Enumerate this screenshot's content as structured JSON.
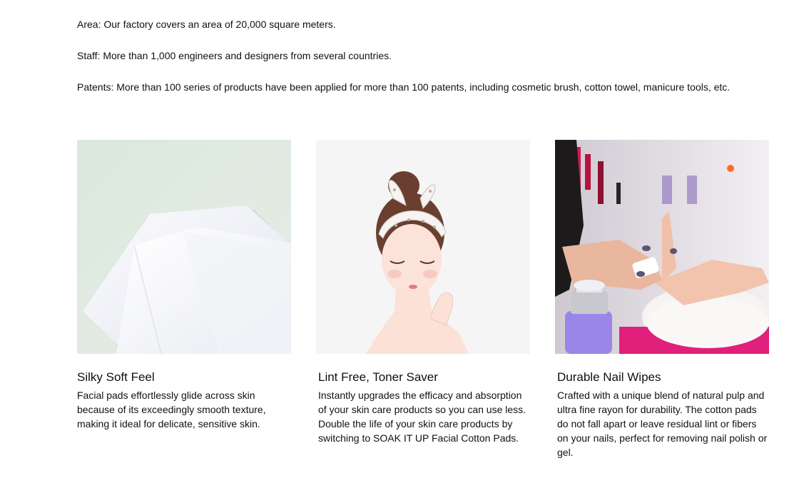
{
  "facts": {
    "area": "Area: Our factory covers an area of 20,000 square meters.",
    "staff": "Staff: More than 1,000 engineers and designers from several countries.",
    "patents": "Patents: More than 100 series of products have been applied for more than 100 patents, including cosmetic brush, cotton towel, manicure tools, etc."
  },
  "cards": [
    {
      "title": "Silky Soft Feel",
      "text": "Facial pads effortlessly glide across skin because of its exceedingly smooth texture, making it ideal for delicate, sensitive skin.",
      "image": "cotton-pads-image"
    },
    {
      "title": "Lint Free, Toner Saver",
      "text": "Instantly upgrades the efficacy and absorption of your skin care products so you can use less. Double the life of your skin care products by switching to SOAK IT UP Facial Cotton Pads.",
      "image": "woman-illustration-image"
    },
    {
      "title": "Durable Nail Wipes",
      "text": "Crafted with a unique blend of natural pulp and ultra fine rayon for durability. The cotton pads do not fall apart or leave residual lint or fibers on your nails, perfect for removing nail polish or gel.",
      "image": "nail-salon-image"
    }
  ],
  "colors": {
    "text": "#0f1111",
    "pad_background": "#dfe9e1",
    "illustration_background": "#f4f4f4",
    "salon_background": "#e9e4ea",
    "towel_pink": "#e0207a",
    "bottle_purple": "#9a86e6"
  }
}
